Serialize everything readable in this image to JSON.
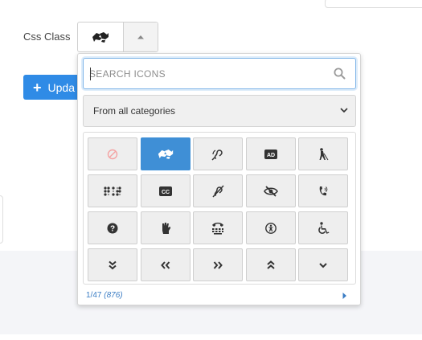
{
  "form": {
    "css_class_label": "Css Class",
    "selected_icon": "american-sign-language-interpreting-icon",
    "update_button": {
      "icon": "plus-icon",
      "label": "Upda"
    }
  },
  "picker": {
    "search": {
      "value": "",
      "placeholder": "SEARCH ICONS",
      "icon": "search-icon"
    },
    "category_select": {
      "selected": "From all categories"
    },
    "grid": [
      [
        "none-icon",
        "american-sign-language-interpreting-icon",
        "assistive-listening-systems-icon",
        "audio-description-icon",
        "blind-icon"
      ],
      [
        "braille-icon",
        "closed-captioning-icon",
        "deaf-icon",
        "low-vision-icon",
        "volume-control-phone-icon"
      ],
      [
        "question-circle-icon",
        "sign-language-icon",
        "tty-icon",
        "universal-access-icon",
        "wheelchair-icon"
      ],
      [
        "angle-double-down-icon",
        "angle-double-left-icon",
        "angle-double-right-icon",
        "angle-double-up-icon",
        "angle-down-icon"
      ]
    ],
    "pager": {
      "page": "1/47",
      "total": "(876)"
    },
    "colors": {
      "accent": "#3f8fd6",
      "button": "#2f8be6",
      "cell_bg": "#eeeeee",
      "footer": "#f4f5f8"
    }
  }
}
